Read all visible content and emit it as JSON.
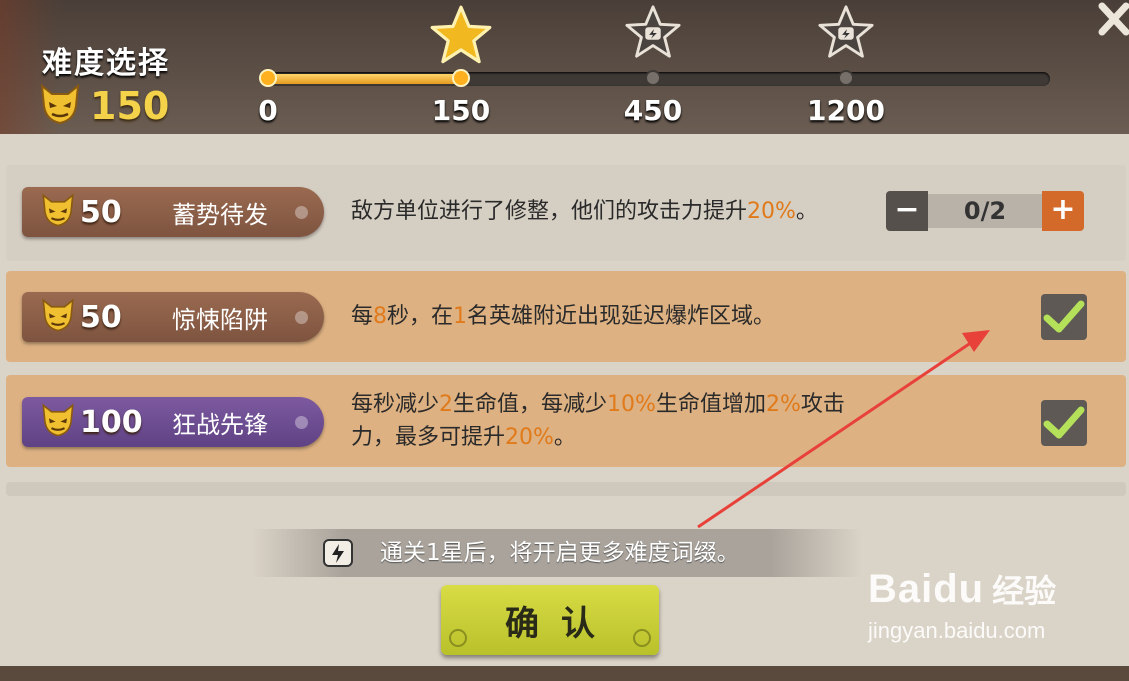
{
  "header": {
    "title": "难度选择",
    "score": "150",
    "progress_fraction": 0.247,
    "milestones": [
      {
        "label": "0",
        "reached": true
      },
      {
        "label": "150",
        "reached": true
      },
      {
        "label": "450",
        "reached": false
      },
      {
        "label": "1200",
        "reached": false
      }
    ]
  },
  "rows": [
    {
      "points": "50",
      "name": "蓄势待发",
      "desc_parts": [
        "敌方单位进行了修整，他们的攻击力提升",
        "20%",
        "。"
      ],
      "control": "stepper",
      "stepper_value": "0/2",
      "minus": "−",
      "plus": "+"
    },
    {
      "points": "50",
      "name": "惊悚陷阱",
      "desc_parts": [
        "每",
        "8",
        "秒，在",
        "1",
        "名英雄附近出现延迟爆炸区域。"
      ],
      "control": "checkbox",
      "checked": true
    },
    {
      "points": "100",
      "name": "狂战先锋",
      "desc_parts": [
        "每秒减少",
        "2",
        "生命值，每减少",
        "10%",
        "生命值增加",
        "2%",
        "攻击力，最多可提升",
        "20%",
        "。"
      ],
      "control": "checkbox",
      "checked": true
    }
  ],
  "hint_text": "通关1星后，将开启更多难度词缀。",
  "confirm_label": "确认",
  "watermark": {
    "brand": "Baidu",
    "cn": "经验",
    "url": "jingyan.baidu.com"
  },
  "colors": {
    "highlight": "#e07a1a",
    "score_gold": "#f4d24a",
    "confirm_green": "#c8cf35",
    "annotation_arrow": "#e8413a"
  }
}
